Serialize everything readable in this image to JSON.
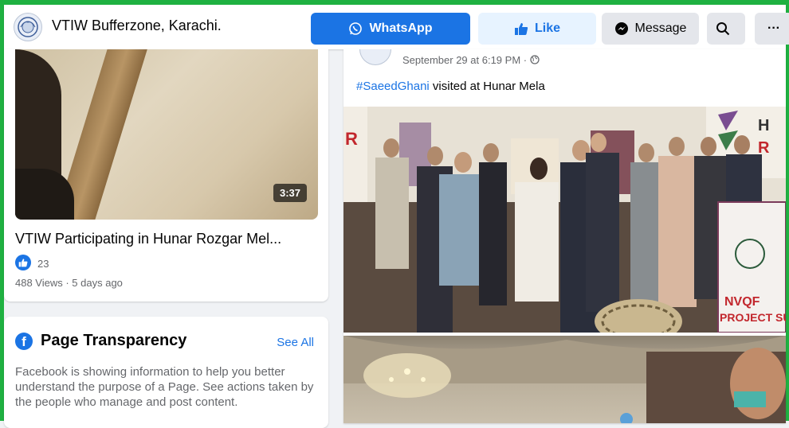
{
  "header": {
    "page_name": "VTIW Bufferzone, Karachi.",
    "whatsapp_label": "WhatsApp",
    "like_label": "Like",
    "message_label": "Message",
    "more_label": "···"
  },
  "video": {
    "duration": "3:37",
    "title": "VTIW Participating in Hunar Rozgar Mel...",
    "likes": "23",
    "meta": "488 Views · 5 days ago"
  },
  "transparency": {
    "title": "Page Transparency",
    "see_all": "See All",
    "description": "Facebook is showing information to help you better understand the purpose of a Page. See actions taken by the people who manage and post content."
  },
  "post": {
    "date": "September 29 at 6:19 PM · ",
    "hashtag": "#SaeedGhani",
    "text": " visited at Hunar Mela",
    "banner_line1": "NVQF",
    "banner_line2": "PROJECT SUPPO"
  },
  "colors": {
    "accent": "#1b74e4",
    "frame": "#1fb141"
  }
}
